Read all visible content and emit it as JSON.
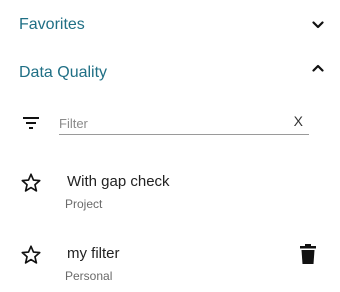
{
  "sections": {
    "favorites": {
      "title": "Favorites",
      "chevron_icon": "chevron-down-icon"
    },
    "data_quality": {
      "title": "Data Quality",
      "chevron_icon": "chevron-up-icon"
    }
  },
  "filter": {
    "placeholder": "Filter",
    "value": "",
    "clear_label": "X",
    "icon": "filter-list-icon"
  },
  "items": [
    {
      "title": "With gap check",
      "subtitle": "Project",
      "favorite_icon": "star-outline-icon",
      "deletable": false
    },
    {
      "title": "my filter",
      "subtitle": "Personal",
      "favorite_icon": "star-outline-icon",
      "deletable": true,
      "delete_icon": "trash-icon"
    }
  ],
  "colors": {
    "accent": "#1f6f85"
  }
}
